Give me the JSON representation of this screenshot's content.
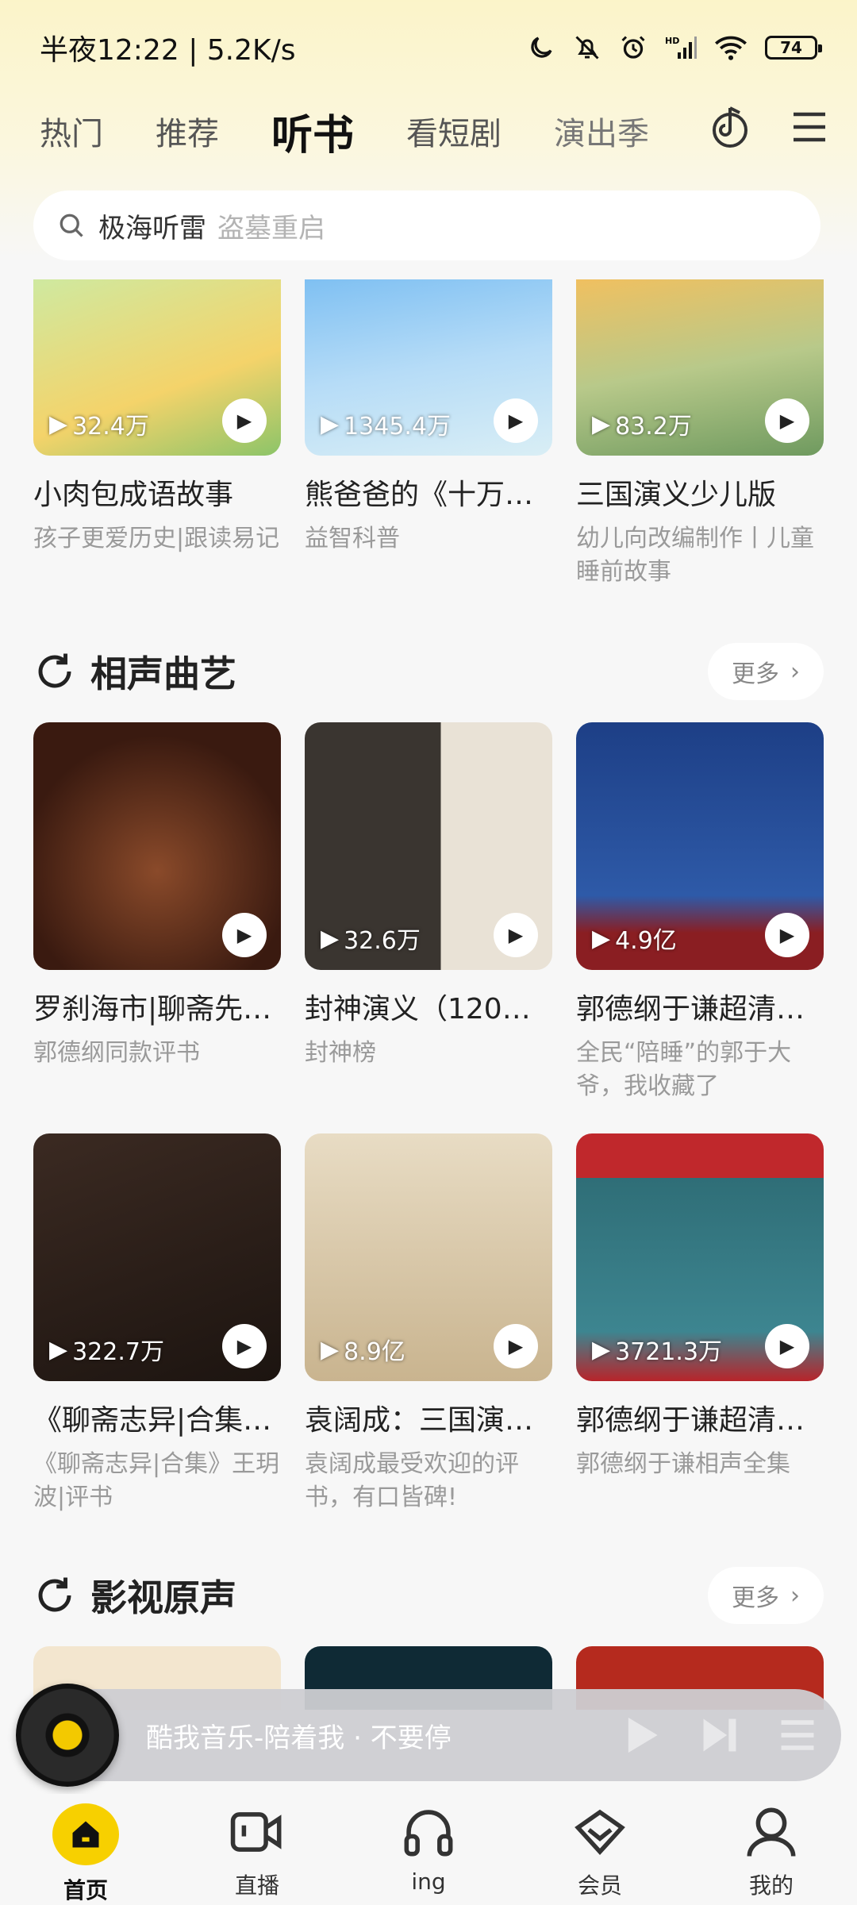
{
  "status": {
    "time_speed": "半夜12:22 | 5.2K/s",
    "battery": "74"
  },
  "tabs": [
    {
      "label": "热门"
    },
    {
      "label": "推荐"
    },
    {
      "label": "听书"
    },
    {
      "label": "看短剧"
    },
    {
      "label": "演出季"
    }
  ],
  "search": {
    "query": "极海听雷",
    "hint": "盗墓重启"
  },
  "row1": [
    {
      "count": "32.4万",
      "title": "小肉包成语故事",
      "sub": "孩子更爱历史|跟读易记"
    },
    {
      "count": "1345.4万",
      "title": "熊爸爸的《十万…",
      "sub": "益智科普"
    },
    {
      "count": "83.2万",
      "title": "三国演义少儿版",
      "sub": "幼儿向改编制作丨儿童睡前故事"
    }
  ],
  "section_xiangsheng": {
    "title": "相声曲艺",
    "more": "更多"
  },
  "row2": [
    {
      "count": "",
      "title": "罗刹海市|聊斋先…",
      "sub": "郭德纲同款评书"
    },
    {
      "count": "32.6万",
      "title": "封神演义（120…",
      "sub": "封神榜"
    },
    {
      "count": "4.9亿",
      "title": "郭德纲于谦超清…",
      "sub": "全民“陪睡”的郭于大爷，我收藏了"
    }
  ],
  "row3": [
    {
      "count": "322.7万",
      "title": "《聊斋志异|合集…",
      "sub": "《聊斋志异|合集》王玥波|评书"
    },
    {
      "count": "8.9亿",
      "title": "袁阔成：三国演…",
      "sub": "袁阔成最受欢迎的评书，有口皆碑!"
    },
    {
      "count": "3721.3万",
      "title": "郭德纲于谦超清…",
      "sub": "郭德纲于谦相声全集"
    }
  ],
  "section_yingshi": {
    "title": "影视原声",
    "more": "更多"
  },
  "player": {
    "song": "酷我音乐-陪着我 · 不要停"
  },
  "nav": [
    {
      "label": "首页"
    },
    {
      "label": "直播"
    },
    {
      "label": "ing"
    },
    {
      "label": "会员"
    },
    {
      "label": "我的"
    }
  ]
}
